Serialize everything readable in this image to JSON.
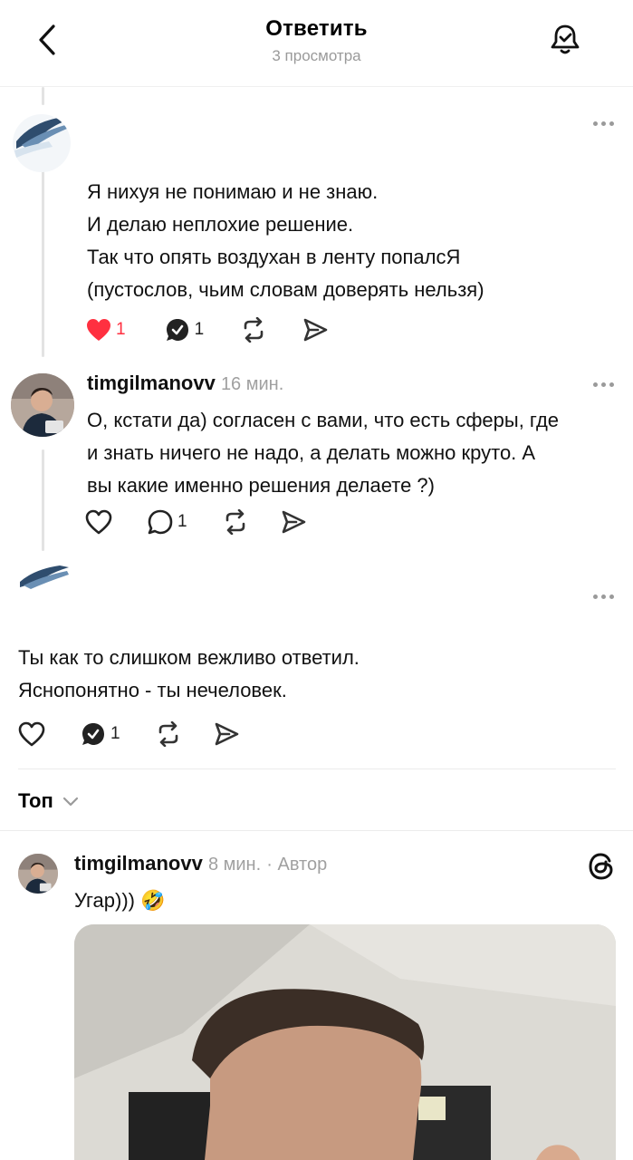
{
  "header": {
    "title": "Ответить",
    "subtitle": "3 просмотра"
  },
  "posts": [
    {
      "username": "",
      "time": "",
      "lines": [
        "Я нихуя не понимаю и не знаю.",
        "И делаю неплохие решение.",
        "Так что опять воздухан в ленту попалсЯ",
        "(пустослов, чьим словам доверять нельзя)"
      ],
      "likes": "1",
      "replies": "1",
      "liked": true
    },
    {
      "username": "timgilmanovv",
      "time": "16 мин.",
      "lines": [
        "О, кстати да) согласен с вами, что есть сферы, где",
        "и знать ничего не надо, а делать можно круто. А",
        "вы какие именно решения делаете ?)"
      ],
      "likes": "",
      "replies": "1"
    },
    {
      "username": "",
      "time": "",
      "lines": [
        "Ты как то слишком вежливо ответил.",
        "Яснопонятно - ты нечеловек."
      ],
      "likes": "",
      "replies": "1"
    }
  ],
  "sort": {
    "label": "Топ"
  },
  "top_reply": {
    "username": "timgilmanovv",
    "time": "8 мин.",
    "badge": "· Автор",
    "text": "Угар)))",
    "emoji": "🤣"
  },
  "icons": {
    "back": "chevron-left-icon",
    "bell": "bell-check-icon",
    "heart": "heart-icon",
    "reply": "comment-icon",
    "repost": "repost-icon",
    "share": "send-icon",
    "threads": "threads-logo-icon"
  },
  "colors": {
    "like_red": "#ff3040",
    "secondary_text": "#9a9a9a"
  }
}
